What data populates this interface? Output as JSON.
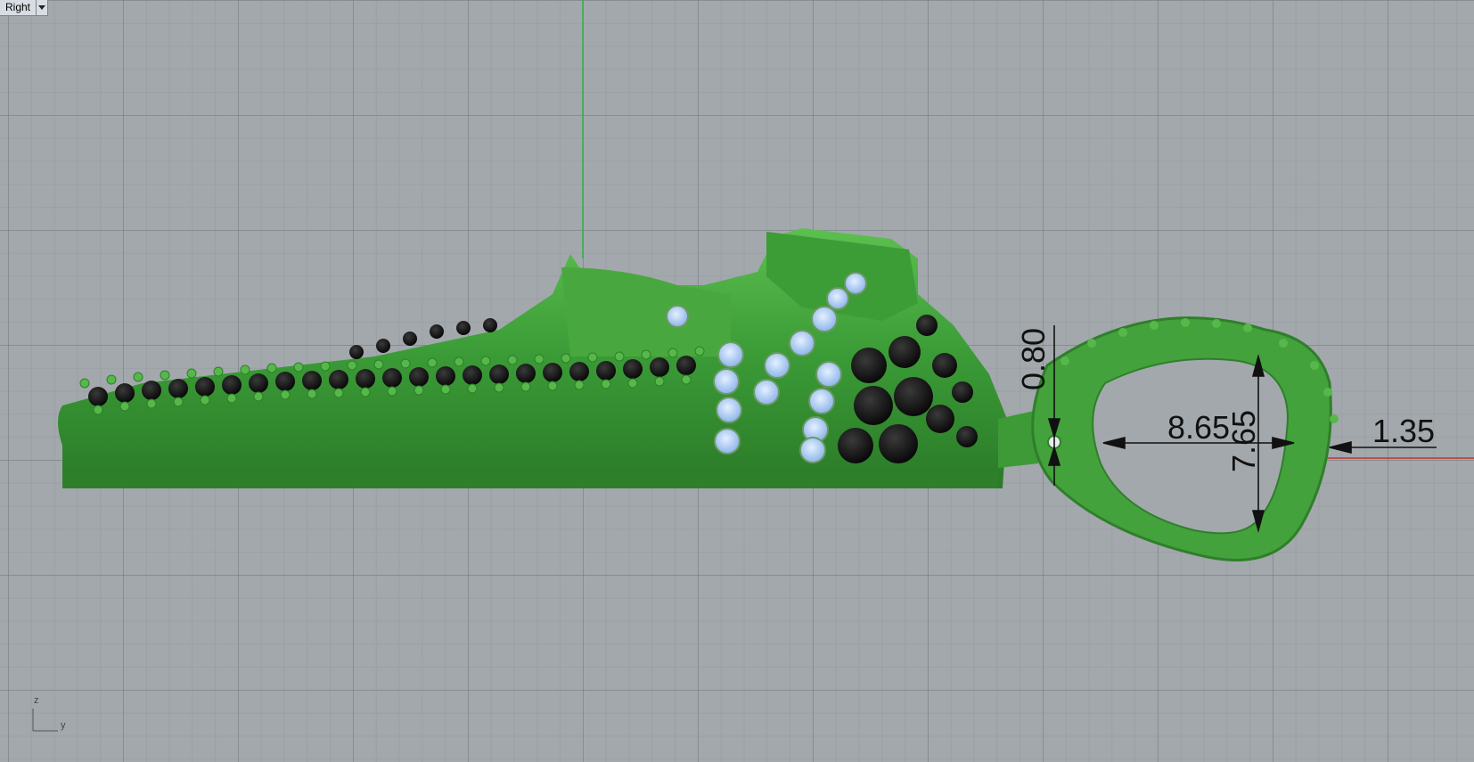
{
  "viewport": {
    "name": "Right",
    "menu_icon": "chevron-down-icon"
  },
  "dimensions": [
    {
      "id": "gap_top",
      "text": "0.80"
    },
    {
      "id": "inner_width",
      "text": "8.65"
    },
    {
      "id": "inner_height",
      "text": "7.65"
    },
    {
      "id": "ring_thickness",
      "text": "1.35"
    }
  ],
  "axes": {
    "z": "z",
    "y": "y"
  },
  "colors": {
    "background": "#a3a8ad",
    "model_green": "#3f9a3a",
    "gem_black": "#111111",
    "gem_blue": "#a8c8f0",
    "x_axis": "#c0392b",
    "z_axis": "#2db34a"
  }
}
